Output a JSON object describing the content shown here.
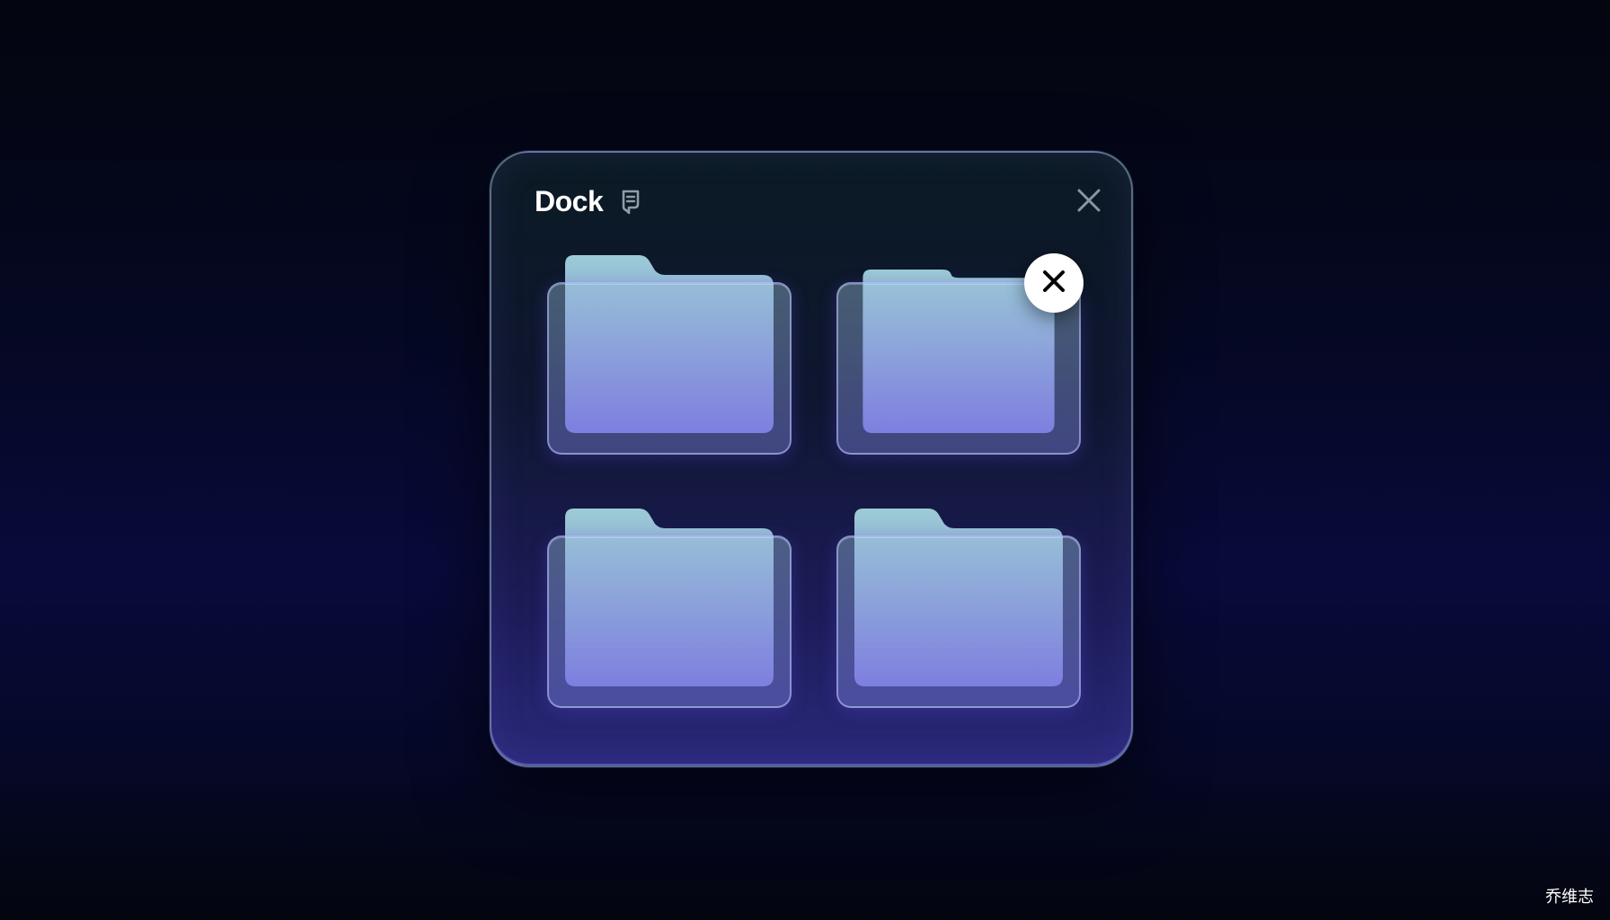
{
  "dock": {
    "title": "Dock",
    "title_icon": "memo-icon",
    "close_icon": "close-icon",
    "folders": [
      {
        "icon": "folder-icon",
        "removable": false
      },
      {
        "icon": "folder-icon",
        "removable": true,
        "remove_icon": "close-icon"
      },
      {
        "icon": "folder-icon",
        "removable": false
      },
      {
        "icon": "folder-icon",
        "removable": false
      }
    ]
  },
  "watermark": "乔维志",
  "colors": {
    "background_top": "#03050f",
    "background_mid": "#080a3a",
    "panel_border": "#96b4c8",
    "folder_top": "#9ccbd6",
    "folder_bottom": "#7a74dc",
    "badge_bg": "#ffffff",
    "badge_icon": "#000000"
  }
}
